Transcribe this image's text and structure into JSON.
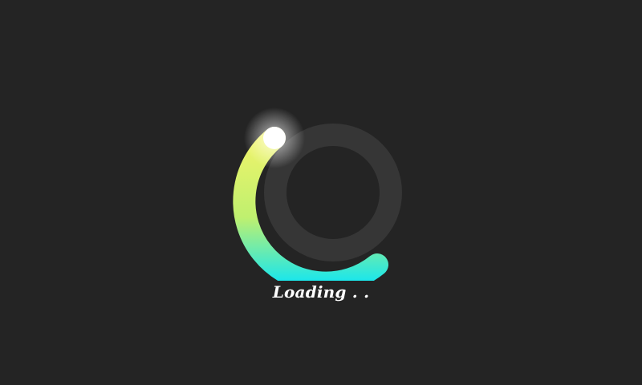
{
  "loader": {
    "status_text": "Loading . .",
    "progress": 0.42,
    "colors": {
      "background": "#242424",
      "track": "#3a3a3a",
      "gradient_start": "#f0f36a",
      "gradient_end": "#16e6ef",
      "glow": "#ffffff"
    }
  }
}
